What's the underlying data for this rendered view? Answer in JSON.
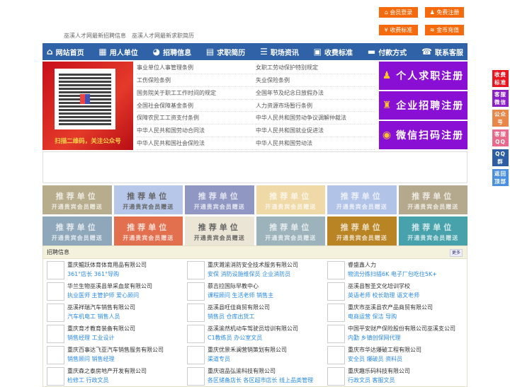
{
  "top_buttons": [
    {
      "label": "会员登录",
      "icon": "home-icon",
      "glyph": "⌂"
    },
    {
      "label": "免费注册",
      "icon": "user-icon",
      "glyph": "♟"
    },
    {
      "label": "收费标准",
      "icon": "yen-icon",
      "glyph": "¥"
    },
    {
      "label": "金币充值",
      "icon": "coins-icon",
      "glyph": "≋"
    }
  ],
  "header_links": [
    "巫溪人才网最新招聘信息",
    "巫溪人才网最新求职简历"
  ],
  "nav": [
    {
      "label": "网站首页",
      "glyph": "⌂",
      "icon": "home-icon"
    },
    {
      "label": "用人单位",
      "glyph": "▦",
      "icon": "building-icon"
    },
    {
      "label": "招聘信息",
      "glyph": "◕",
      "icon": "chat-icon"
    },
    {
      "label": "求职简历",
      "glyph": "▤",
      "icon": "resume-icon"
    },
    {
      "label": "职场资讯",
      "glyph": "☰",
      "icon": "news-icon"
    },
    {
      "label": "收费标准",
      "glyph": "▣",
      "icon": "bag-icon"
    },
    {
      "label": "付款方式",
      "glyph": "▬",
      "icon": "card-icon"
    },
    {
      "label": "联系客服",
      "glyph": "☎",
      "icon": "phone-icon"
    }
  ],
  "qr": {
    "caption": "扫描二维码，关注公众号"
  },
  "laws": [
    "事业单位人事管理条例",
    "女职工劳动保护特别规定",
    "工伤保险条例",
    "失业保险条例",
    "国务院关于职工工作时间的规定",
    "全国年节及纪念日放假办法",
    "全国社会保障基金条例",
    "人力资源市场暂行条例",
    "保障农民工工资支付条例",
    "中华人民共和国劳动争议调解仲裁法",
    "中华人民共和国劳动合同法",
    "中华人民共和国就业促进法",
    "中华人民共和国社会保险法",
    "中华人民共和国劳动法"
  ],
  "register": [
    {
      "label": "个人求职注册",
      "glyph": "♟",
      "icon": "person-icon"
    },
    {
      "label": "企业招聘注册",
      "glyph": "♜",
      "icon": "company-icon"
    },
    {
      "label": "微信扫码注册",
      "glyph": "◉",
      "icon": "wechat-icon"
    }
  ],
  "tiles": {
    "title": "推荐单位",
    "subtitle": "开通贵宾会员赠送",
    "colors": [
      "#b7ac8b",
      "#b6c7ea",
      "#9097c2",
      "#efd9a7",
      "#b2c3e8",
      "#b4a98d",
      "#8fa7ba",
      "#e2704f",
      "#ebe5d6",
      "#9db3bb",
      "#b98524",
      "#47a2ab"
    ]
  },
  "recruit": {
    "title": "招聘信息",
    "more": "更多",
    "items": [
      {
        "company": "重庆鲲跃体育体育用品有限公司",
        "jobs": "361°店长 361°导购"
      },
      {
        "company": "重庆濉渝消防安全技术服务有限公司",
        "jobs": "安保 消防设施维保员 企业消防员"
      },
      {
        "company": "睿盛鑫人力",
        "jobs": "物流分拣扫描6K 电子厂包吃住5K+"
      },
      {
        "company": "华兰生物巫溪县单采血浆有限公司",
        "jobs": "执业医师 主管护师 爱心顾问"
      },
      {
        "company": "慕吉拉国际早教中心",
        "jobs": "课程顾问 生活老师 销售主"
      },
      {
        "company": "巫溪县智圣文化培训学校",
        "jobs": "英语老师 校长助理 语文老师"
      },
      {
        "company": "巫溪祥瑞汽车销售有限公司",
        "jobs": "汽车机电工 销售人员"
      },
      {
        "company": "巫溪县旺佳商贸有限公司",
        "jobs": "销售员 仓库出货工"
      },
      {
        "company": "重庆市巫溪县农产品商贸有限公司",
        "jobs": "电商运营 保洁 导购"
      },
      {
        "company": "重庆育才教育装备有限公司",
        "jobs": "销售经理 工业设计"
      },
      {
        "company": "巫溪渝然机动车驾驶员培训有限公司",
        "jobs": "C1教练员 办公室文员"
      },
      {
        "company": "中国平安财产保险股份有限公司巫溪支公司",
        "jobs": "内勤 乡镇创保网代理"
      },
      {
        "company": "重庆百事达飞亚汽车销售服务有限公司",
        "jobs": "销售顾问 销售经理"
      },
      {
        "company": "重庆优景禾澜营销策划有限公司",
        "jobs": "渠道专员"
      },
      {
        "company": "重庆市华达爆破工程有限公司",
        "jobs": "安全员 爆破员 资料员"
      },
      {
        "company": "重庆森之泰房地产开发有限公司",
        "jobs": "检修工 行政文员"
      },
      {
        "company": "重庆谊品弘渝科技有限公司",
        "jobs": "各区储备店长 各区超市店长 线上品类管理"
      },
      {
        "company": "重庆趣乐码科技有限公司",
        "jobs": "行政文员 客服文员"
      }
    ]
  },
  "sidebar": [
    {
      "label": "收费标准",
      "color": "#e8141e"
    },
    {
      "label": "客服微信",
      "color": "#8a1fc8"
    },
    {
      "label": "公众号",
      "color": "#e8874a"
    },
    {
      "label": "客服QQ号",
      "color": "#e86a8a"
    },
    {
      "label": "QQ群",
      "color": "#2d5ea3"
    },
    {
      "label": "返回顶部",
      "color": "#4a90dc"
    }
  ]
}
